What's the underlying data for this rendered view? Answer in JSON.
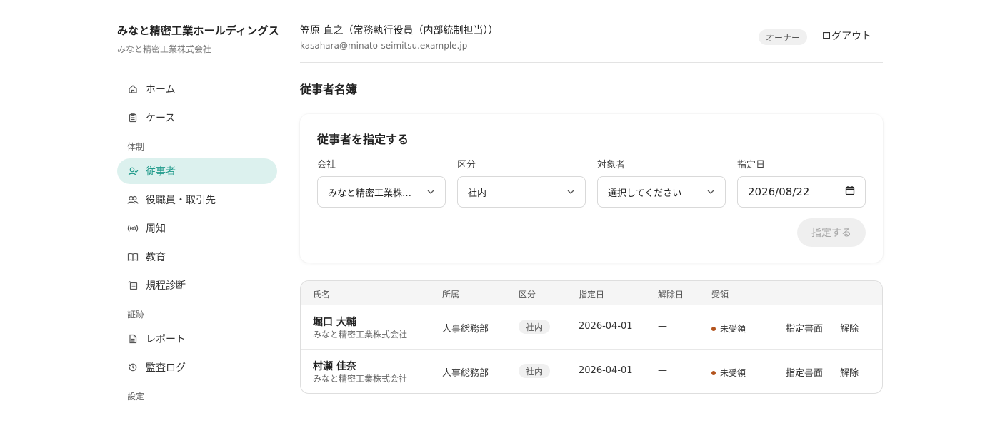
{
  "org": {
    "name": "みなと精密工業ホールディングス",
    "sub": "みなと精密工業株式会社"
  },
  "nav": {
    "home": "ホーム",
    "cases": "ケース",
    "section_structure": "体制",
    "workers": "従事者",
    "officers": "役職員・取引先",
    "notice": "周知",
    "education": "教育",
    "rules": "規程診断",
    "section_evidence": "証跡",
    "report": "レポート",
    "audit_log": "監査ログ",
    "section_settings": "設定"
  },
  "header": {
    "user_name": "笠原 直之（常務執行役員（内部統制担当））",
    "user_email": "kasahara@minato-seimitsu.example.jp",
    "role": "オーナー",
    "logout": "ログアウト"
  },
  "page": {
    "title": "従事者名簿"
  },
  "form": {
    "title": "従事者を指定する",
    "company_label": "会社",
    "company_value": "みなと精密工業株式会社",
    "category_label": "区分",
    "category_value": "社内",
    "target_label": "対象者",
    "target_value": "選択してください",
    "date_label": "指定日",
    "date_value": "2026/08/22",
    "submit": "指定する"
  },
  "table": {
    "headers": {
      "name": "氏名",
      "dept": "所属",
      "category": "区分",
      "assigned": "指定日",
      "released": "解除日",
      "receipt": "受領"
    },
    "rows": [
      {
        "name": "堀口 大輔",
        "company": "みなと精密工業株式会社",
        "dept": "人事総務部",
        "category": "社内",
        "assigned": "2026-04-01",
        "released": "—",
        "receipt": "未受領",
        "doc_link": "指定書面",
        "release_link": "解除"
      },
      {
        "name": "村瀬 佳奈",
        "company": "みなと精密工業株式会社",
        "dept": "人事総務部",
        "category": "社内",
        "assigned": "2026-04-01",
        "released": "—",
        "receipt": "未受領",
        "doc_link": "指定書面",
        "release_link": "解除"
      }
    ]
  },
  "colors": {
    "accent": "#1f9a8a",
    "accent_bg": "#dcf1ee",
    "status_dot": "#b3541e"
  }
}
